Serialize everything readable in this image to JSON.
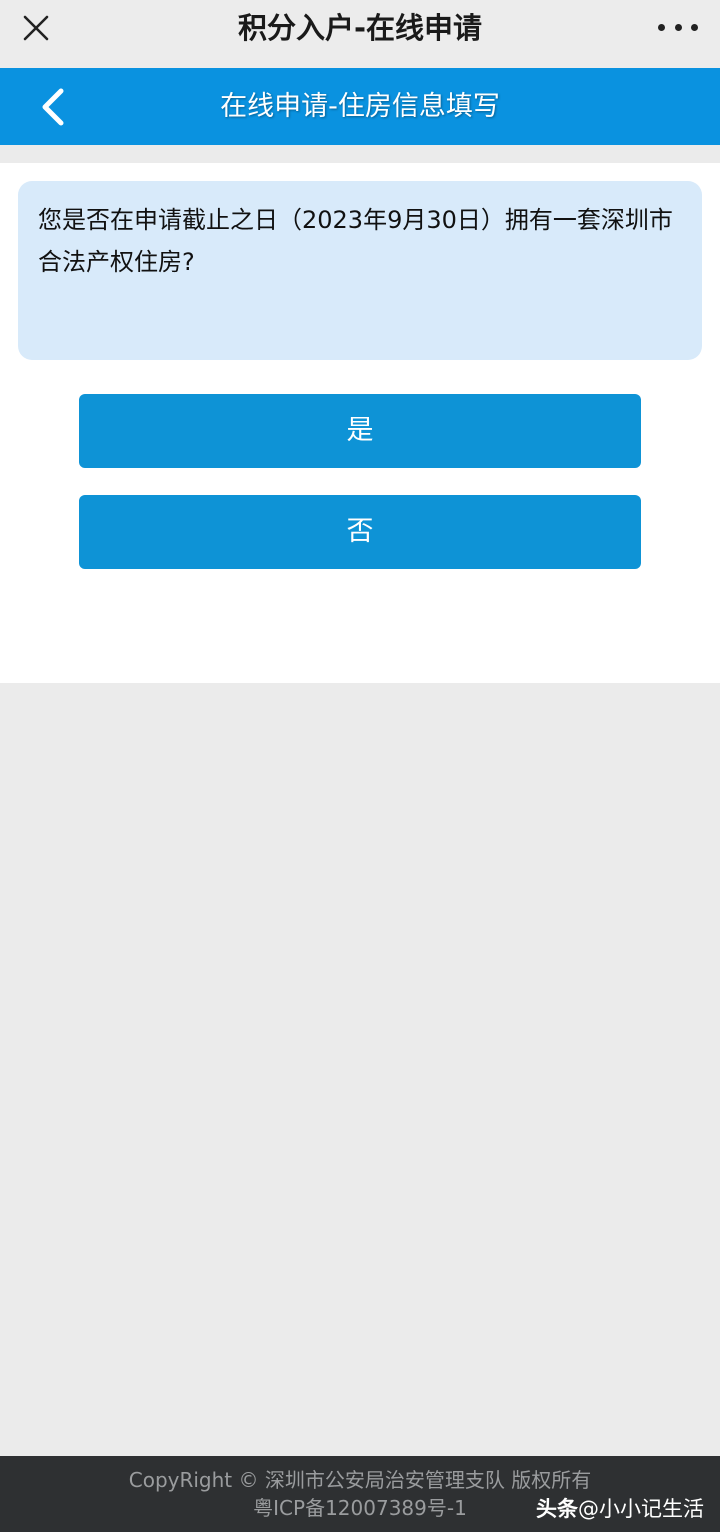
{
  "topbar": {
    "title": "积分入户-在线申请",
    "close_icon": "close-icon",
    "more_icon": "more-icon"
  },
  "navbar": {
    "title": "在线申请-住房信息填写",
    "back_icon": "chevron-left-icon",
    "color": "#0a92e0"
  },
  "question": {
    "text": "您是否在申请截止之日（2023年9月30日）拥有一套深圳市合法产权住房?"
  },
  "buttons": {
    "yes": "是",
    "no": "否",
    "color": "#0e93d6"
  },
  "footer": {
    "line1": "CopyRight © 深圳市公安局治安管理支队 版权所有",
    "line2": "粤ICP备12007389号-1"
  },
  "watermark": {
    "brand": "头条",
    "handle": "@小小记生活"
  }
}
